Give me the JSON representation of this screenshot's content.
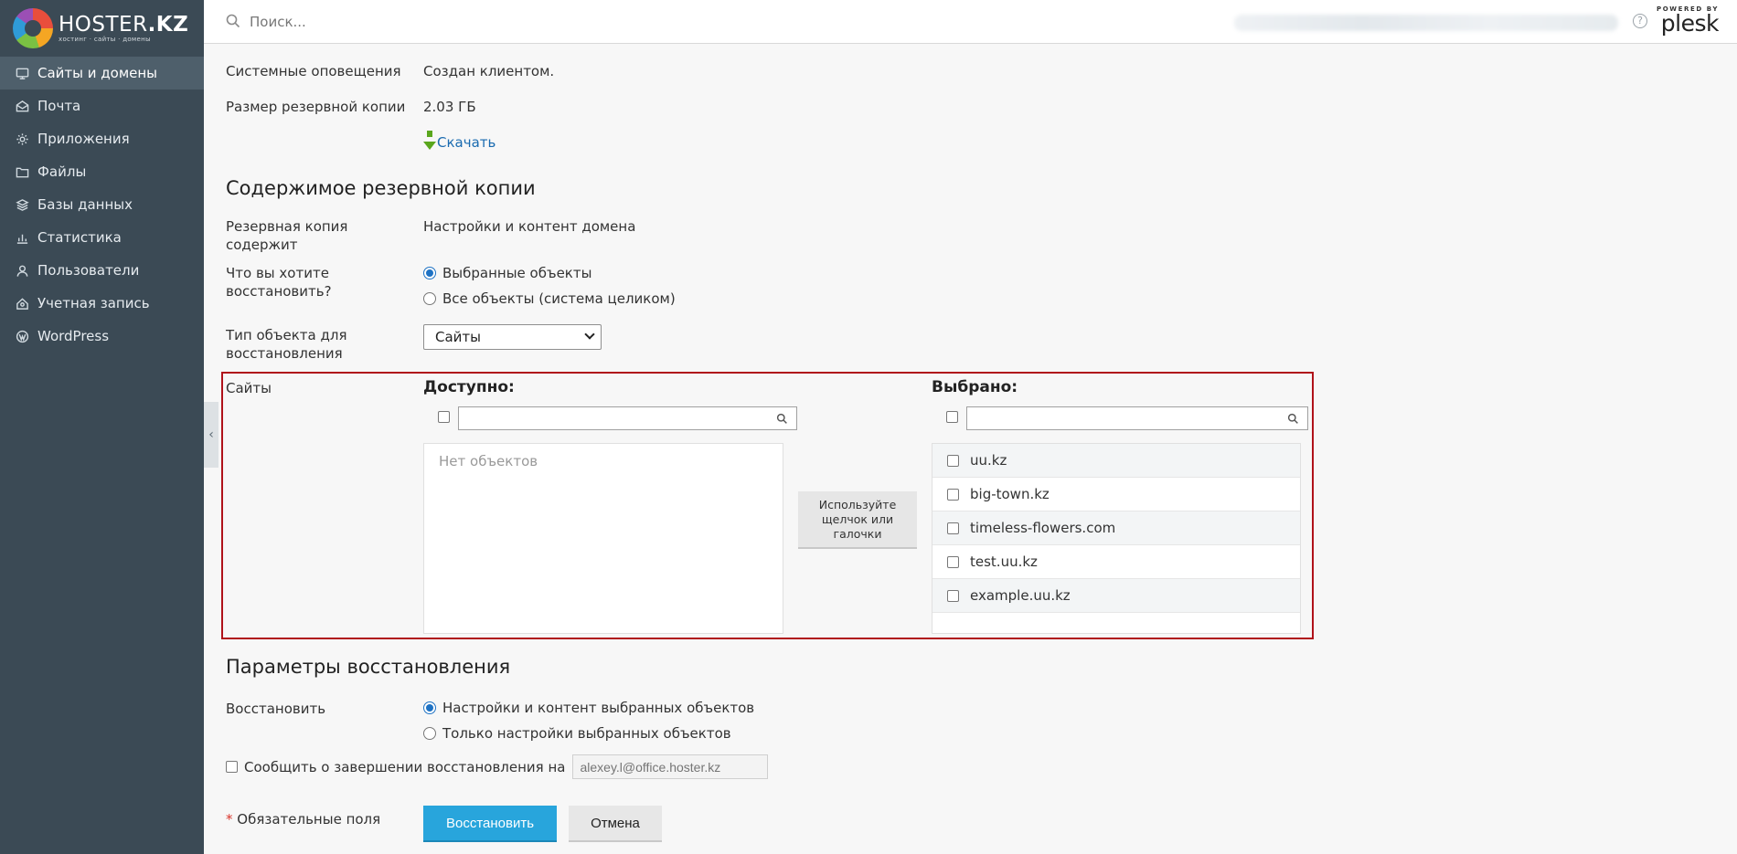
{
  "brand": {
    "name": "HOSTER",
    "suffix": ".KZ",
    "tagline": "хостинг · сайты · домены"
  },
  "sidebar": {
    "items": [
      {
        "label": "Сайты и домены",
        "icon": "monitor-icon",
        "active": true
      },
      {
        "label": "Почта",
        "icon": "mail-icon"
      },
      {
        "label": "Приложения",
        "icon": "gear-icon"
      },
      {
        "label": "Файлы",
        "icon": "folder-icon"
      },
      {
        "label": "Базы данных",
        "icon": "database-icon"
      },
      {
        "label": "Статистика",
        "icon": "bar-chart-icon"
      },
      {
        "label": "Пользователи",
        "icon": "user-icon"
      },
      {
        "label": "Учетная запись",
        "icon": "account-icon"
      },
      {
        "label": "WordPress",
        "icon": "wordpress-icon"
      }
    ],
    "collapse_glyph": "‹"
  },
  "header": {
    "search_placeholder": "Поиск...",
    "powered_by": "POWERED BY",
    "plesk": "plesk",
    "help_glyph": "?"
  },
  "details": {
    "notifications_label": "Системные оповещения",
    "notifications_value": "Создан клиентом.",
    "size_label": "Размер резервной копии",
    "size_value": "2.03 ГБ",
    "download_label": "Скачать"
  },
  "contents": {
    "heading": "Содержимое резервной копии",
    "contains_label": "Резервная копия содержит",
    "contains_value": "Настройки и контент домена",
    "restore_what_label": "Что вы хотите восстановить?",
    "restore_what_options": [
      "Выбранные объекты",
      "Все объекты (система целиком)"
    ],
    "restore_what_selected": 0,
    "object_type_label": "Тип объекта для восстановления",
    "object_type_value": "Сайты"
  },
  "picker": {
    "section_label": "Сайты",
    "available_title": "Доступно:",
    "available_empty": "Нет объектов",
    "selected_title": "Выбрано:",
    "hint_button": "Используйте щелчок или галочки",
    "selected_items": [
      "uu.kz",
      "big-town.kz",
      "timeless-flowers.com",
      "test.uu.kz",
      "example.uu.kz"
    ]
  },
  "params": {
    "heading": "Параметры восстановления",
    "restore_label": "Восстановить",
    "restore_options": [
      "Настройки и контент выбранных объектов",
      "Только настройки выбранных объектов"
    ],
    "restore_selected": 0,
    "notify_label": "Сообщить о завершении восстановления на",
    "notify_email_placeholder": "alexey.l@office.hoster.kz"
  },
  "footer": {
    "required_star": "*",
    "required_label": "Обязательные поля",
    "restore_button": "Восстановить",
    "cancel_button": "Отмена"
  },
  "colors": {
    "sidebar": "#3b4a55",
    "primary": "#28a5dc",
    "highlight_border": "#b0121a",
    "link": "#1a6bb0",
    "download_arrow": "#5aa61d"
  }
}
